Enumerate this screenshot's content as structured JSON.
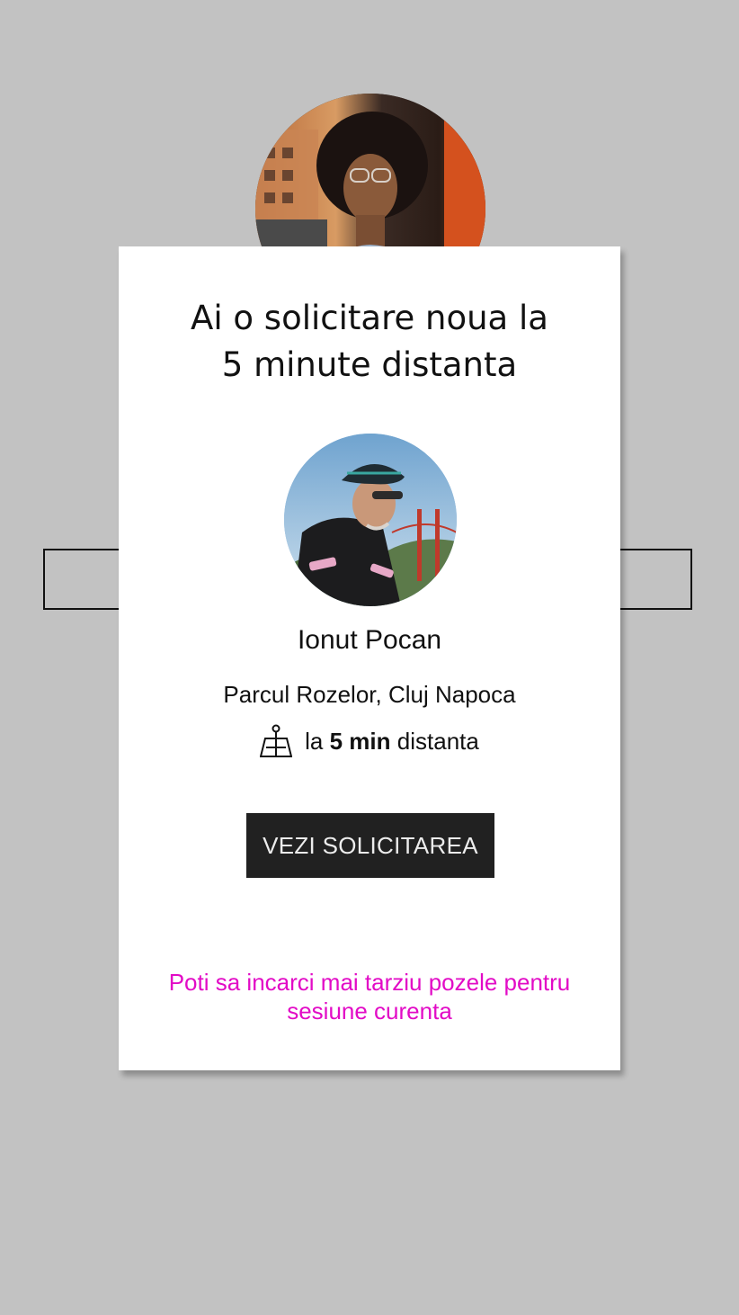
{
  "background": {
    "avatar_icon": "user-avatar-photo"
  },
  "modal": {
    "title_line1": "Ai o solicitare noua la",
    "title_line2": "5 minute distanta",
    "requester": {
      "avatar_icon": "cyclist-avatar-photo",
      "name": "Ionut Pocan",
      "location": "Parcul Rozelor, Cluj Napoca"
    },
    "distance": {
      "icon": "map-pin-icon",
      "prefix": "la",
      "value": "5 min",
      "suffix": "distanta"
    },
    "button_label": "VEZI SOLICITAREA",
    "footer_note": "Poti sa incarci mai tarziu pozele pentru sesiune curenta"
  },
  "colors": {
    "overlay_background": "#c2c2c2",
    "modal_background": "#ffffff",
    "button_background": "#212121",
    "button_text": "#ececec",
    "accent_magenta": "#e20bc6"
  }
}
